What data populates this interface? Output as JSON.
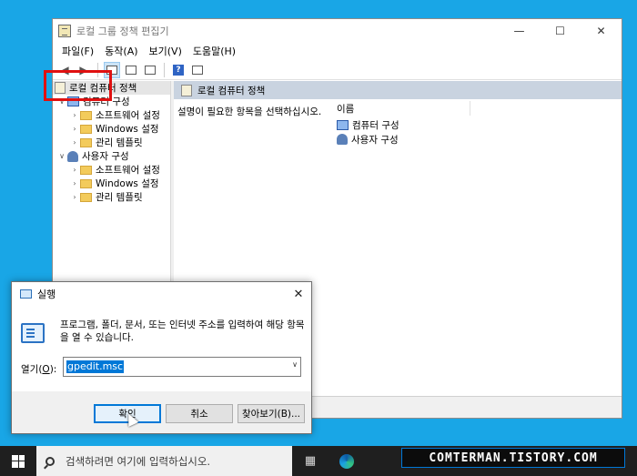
{
  "gpedit": {
    "title": "로컬 그룹 정책 편집기",
    "menu": [
      "파일(F)",
      "동작(A)",
      "보기(V)",
      "도움말(H)"
    ],
    "tree": {
      "root": "로컬 컴퓨터 정책",
      "computer_config": "컴퓨터 구성",
      "computer_children": [
        "소프트웨어 설정",
        "Windows 설정",
        "관리 템플릿"
      ],
      "user_config": "사용자 구성",
      "user_children": [
        "소프트웨어 설정",
        "Windows 설정",
        "관리 템플릿"
      ]
    },
    "pane_header": "로컬 컴퓨터 정책",
    "description": "설명이 필요한 항목을 선택하십시오.",
    "list_header": "이름",
    "list_items": [
      "컴퓨터 구성",
      "사용자 구성"
    ]
  },
  "run_dialog": {
    "title": "실행",
    "description": "프로그램, 폴더, 문서, 또는 인터넷 주소를 입력하여 해당 항목을 열 수 있습니다.",
    "open_label": "열기(",
    "open_label_key": "O",
    "open_label_end": "):",
    "input_value": "gpedit.msc",
    "ok": "확인",
    "cancel": "취소",
    "browse": "찾아보기(B)..."
  },
  "taskbar": {
    "search_placeholder": "검색하려면 여기에 입력하십시오."
  },
  "watermark": "COMTERMAN.TISTORY.COM",
  "colors": {
    "desktop": "#19a6e6",
    "highlight": "#e01010",
    "selection": "#0078d7"
  }
}
